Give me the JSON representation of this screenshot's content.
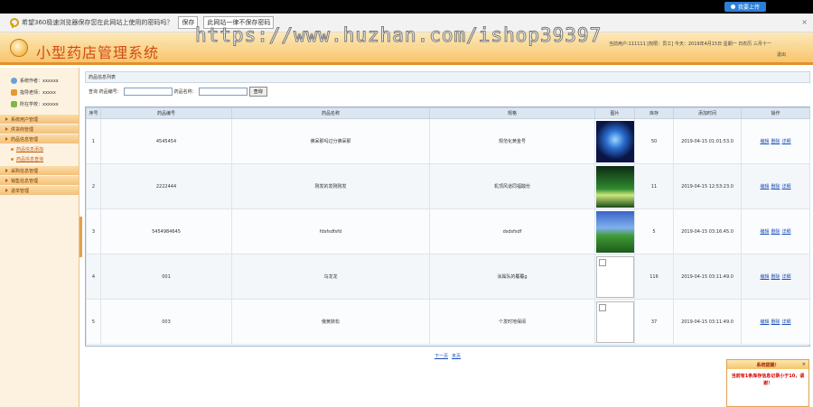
{
  "topbar": {
    "upload_label": "我要上传"
  },
  "password_bar": {
    "prompt": "希望360极速浏览器保存您在此网站上使用的密码吗？",
    "save_label": "保存",
    "never_label": "此网站一律不保存密码",
    "close": "×"
  },
  "header": {
    "title": "小型药店管理系统",
    "user_info": "当前用户:111111 [权限：员工]  今天：2019年4月15日 星期一 日农历 三月十一",
    "logout": "退出",
    "watermark": "https://www.huzhan.com/ishop39397"
  },
  "sidebar": {
    "info": [
      {
        "label": "系统作者：xxxxxx"
      },
      {
        "label": "指导老师：xxxxx"
      },
      {
        "label": "所在学校：xxxxxx"
      }
    ],
    "menu": [
      {
        "label": "系统用户管理"
      },
      {
        "label": "供货商管理"
      },
      {
        "label": "药品信息管理",
        "sub": [
          "药品信息添加",
          "药品信息查询"
        ]
      },
      {
        "label": "采购信息管理"
      },
      {
        "label": "销售信息管理"
      },
      {
        "label": "退单管理"
      }
    ]
  },
  "content": {
    "breadcrumb": "药品信息列表",
    "search": {
      "code_label": "查询 药品编号：",
      "name_label": "药品名称：",
      "button": "查询",
      "code_value": "",
      "name_value": ""
    },
    "table": {
      "headers": [
        "序号",
        "药品编号",
        "药品名称",
        "规格",
        "图片",
        "库存",
        "添加时间",
        "操作"
      ],
      "rows": [
        {
          "no": "1",
          "code": "4545454",
          "name": "佛呆那吗过分佛呆那",
          "spec": "规范化黄金号",
          "image": "space",
          "stock": "50",
          "time": "2019-04-15 01:01:53.0"
        },
        {
          "no": "2",
          "code": "2222444",
          "name": "刚发的发刚刚发",
          "spec": "机顶风道同福酸份",
          "image": "forest",
          "stock": "11",
          "time": "2019-04-15 12:53:23.0"
        },
        {
          "no": "3",
          "code": "5454984645",
          "name": "fdsfsdfsfd",
          "spec": "dsdsfsdf",
          "image": "landscape",
          "stock": "5",
          "time": "2019-04-15 03:16:45.0"
        },
        {
          "no": "4",
          "code": "001",
          "name": "乌龙龙",
          "spec": "涂属队的覆覆g",
          "image": "broken",
          "stock": "116",
          "time": "2019-04-15 03:11:49.0"
        },
        {
          "no": "5",
          "code": "003",
          "name": "俄黄默松",
          "spec": "个发时地保阔",
          "image": "broken",
          "stock": "37",
          "time": "2019-04-15 03:11:49.0"
        }
      ],
      "ops": {
        "edit": "编辑",
        "delete": "删除",
        "detail": "详细"
      }
    },
    "pager": {
      "next": "下一页",
      "last": "末页"
    }
  },
  "popup": {
    "title": "系统提醒！",
    "message": "当前有1条库存信息记录小于10，请谢！",
    "close": "×"
  }
}
